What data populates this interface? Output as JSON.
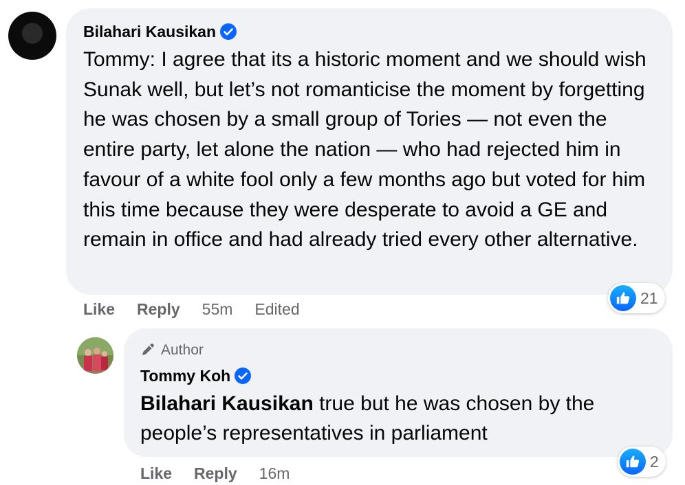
{
  "comment": {
    "author": "Bilahari Kausikan",
    "verified": true,
    "text": "Tommy: I agree that its a historic moment and we should wish Sunak well, but let’s not romanticise the moment by forgetting he was chosen by a small group of Tories — not even the entire party, let alone the nation — who had rejected him in favour of a white fool only a few months ago but voted for him this time because they were desperate to avoid a GE and remain in office and had already tried every other alternative.",
    "actions": {
      "like": "Like",
      "reply": "Reply",
      "time": "55m",
      "edited": "Edited"
    },
    "reactions": {
      "icon": "thumbs-up-icon",
      "count": "21"
    }
  },
  "reply": {
    "badge": "Author",
    "author": "Tommy Koh",
    "verified": true,
    "mention": "Bilahari Kausikan",
    "text": " true but he was chosen by the people’s representatives in parliament",
    "actions": {
      "like": "Like",
      "reply": "Reply",
      "time": "16m"
    },
    "reactions": {
      "icon": "thumbs-up-icon",
      "count": "2"
    }
  },
  "colors": {
    "bubble": "#f0f2f5",
    "meta": "#65676b",
    "verified": "#0866ff"
  }
}
